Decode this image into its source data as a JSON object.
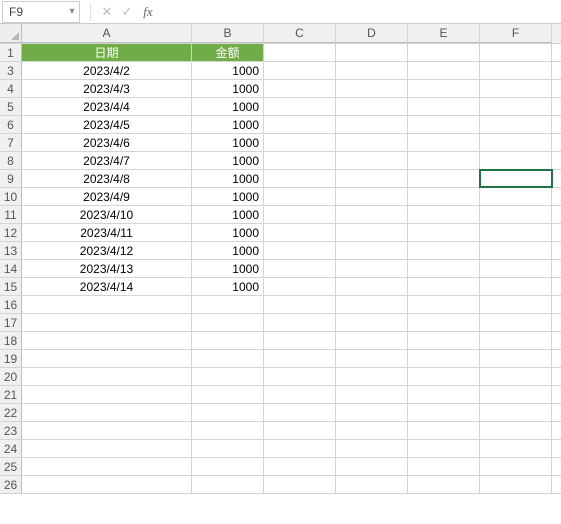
{
  "nameBox": {
    "value": "F9",
    "dropdownGlyph": "▾"
  },
  "formulaBar": {
    "cancelGlyph": "✕",
    "confirmGlyph": "✓",
    "fxLabel": "fx",
    "formula": ""
  },
  "columns": [
    "A",
    "B",
    "C",
    "D",
    "E",
    "F"
  ],
  "rowHeaders": [
    1,
    3,
    4,
    5,
    6,
    7,
    8,
    9,
    10,
    11,
    12,
    13,
    14,
    15,
    16,
    17,
    18,
    19,
    20,
    21,
    22,
    23,
    24,
    25,
    26
  ],
  "tableHeader": {
    "A": "日期",
    "B": "金额"
  },
  "rows": [
    {
      "date": "2023/4/2",
      "amount": 1000
    },
    {
      "date": "2023/4/3",
      "amount": 1000
    },
    {
      "date": "2023/4/4",
      "amount": 1000
    },
    {
      "date": "2023/4/5",
      "amount": 1000
    },
    {
      "date": "2023/4/6",
      "amount": 1000
    },
    {
      "date": "2023/4/7",
      "amount": 1000
    },
    {
      "date": "2023/4/8",
      "amount": 1000
    },
    {
      "date": "2023/4/9",
      "amount": 1000
    },
    {
      "date": "2023/4/10",
      "amount": 1000
    },
    {
      "date": "2023/4/11",
      "amount": 1000
    },
    {
      "date": "2023/4/12",
      "amount": 1000
    },
    {
      "date": "2023/4/13",
      "amount": 1000
    },
    {
      "date": "2023/4/14",
      "amount": 1000
    }
  ],
  "activeCell": "F9",
  "colors": {
    "headerFill": "#70ad47",
    "selection": "#217346"
  },
  "chart_data": {
    "type": "table",
    "columns": [
      "日期",
      "金额"
    ],
    "data": [
      [
        "2023/4/2",
        1000
      ],
      [
        "2023/4/3",
        1000
      ],
      [
        "2023/4/4",
        1000
      ],
      [
        "2023/4/5",
        1000
      ],
      [
        "2023/4/6",
        1000
      ],
      [
        "2023/4/7",
        1000
      ],
      [
        "2023/4/8",
        1000
      ],
      [
        "2023/4/9",
        1000
      ],
      [
        "2023/4/10",
        1000
      ],
      [
        "2023/4/11",
        1000
      ],
      [
        "2023/4/12",
        1000
      ],
      [
        "2023/4/13",
        1000
      ],
      [
        "2023/4/14",
        1000
      ]
    ]
  }
}
